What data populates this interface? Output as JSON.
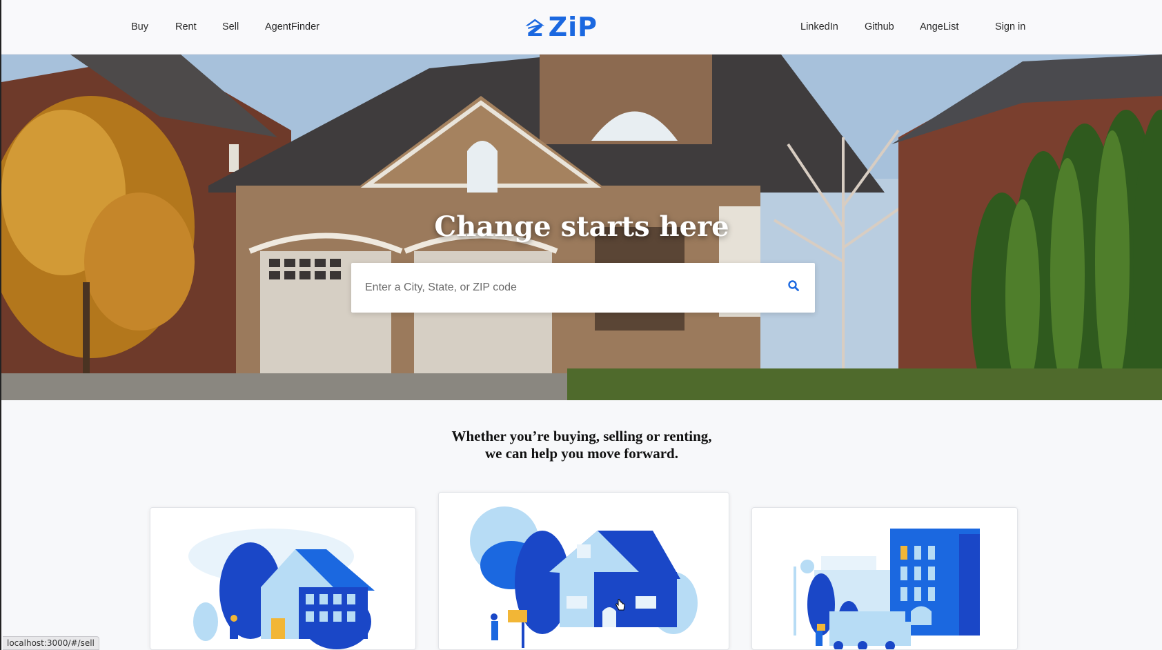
{
  "nav": {
    "left_links": [
      "Buy",
      "Rent",
      "Sell",
      "AgentFinder"
    ],
    "logo_text": "ZiP",
    "right_links": [
      "LinkedIn",
      "Github",
      "AngeList"
    ],
    "signin": "Sign in"
  },
  "hero": {
    "title": "Change starts here",
    "search_placeholder": "Enter a City, State, or ZIP code"
  },
  "tagline": {
    "line1": "Whether you’re buying, selling or renting,",
    "line2": "we can help you move forward."
  },
  "status_bar": "localhost:3000/#/sell",
  "colors": {
    "brand": "#1b68e0",
    "illustration_dark": "#1a47c7",
    "illustration_light": "#b7dcf5"
  }
}
